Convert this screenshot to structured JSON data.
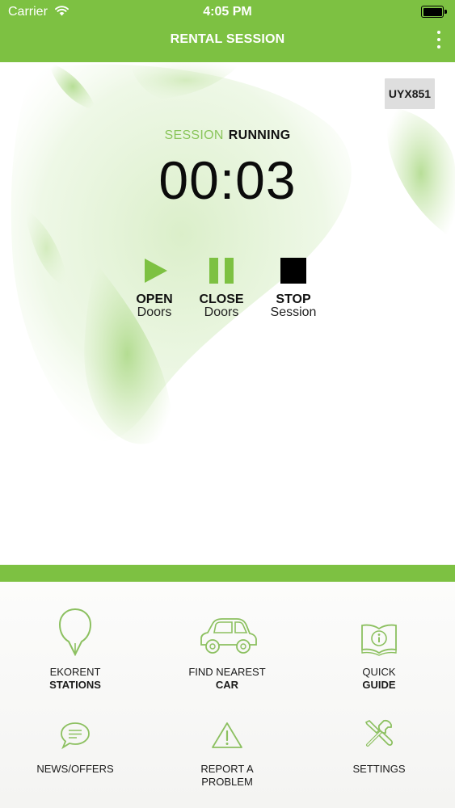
{
  "status_bar": {
    "carrier": "Carrier",
    "time": "4:05 PM"
  },
  "nav": {
    "title": "RENTAL SESSION",
    "menu_icon": "more-vertical-icon"
  },
  "session": {
    "plate": "UYX851",
    "status_label": "SESSION",
    "status_value": "RUNNING",
    "timer": "00:03"
  },
  "controls": [
    {
      "icon": "play-icon",
      "line1": "OPEN",
      "line2": "Doors"
    },
    {
      "icon": "pause-icon",
      "line1": "CLOSE",
      "line2": "Doors"
    },
    {
      "icon": "stop-icon",
      "line1": "STOP",
      "line2": "Session"
    }
  ],
  "menu": [
    {
      "icon": "map-pin-icon",
      "line1": "EKORENT",
      "line2": "STATIONS"
    },
    {
      "icon": "car-icon",
      "line1": "FIND NEAREST",
      "line2": "CAR"
    },
    {
      "icon": "info-book-icon",
      "line1": "QUICK",
      "line2": "GUIDE"
    },
    {
      "icon": "chat-bubble-icon",
      "line1": "NEWS/OFFERS"
    },
    {
      "icon": "warning-icon",
      "line1": "REPORT A",
      "line2": "PROBLEM"
    },
    {
      "icon": "tools-icon",
      "line1": "SETTINGS"
    }
  ],
  "colors": {
    "brand_green": "#7dc142",
    "light_green_text": "#8ac55b",
    "icon_green": "#8cc060",
    "badge_bg": "#dedede",
    "menu_bg": "#f7f7f5"
  }
}
